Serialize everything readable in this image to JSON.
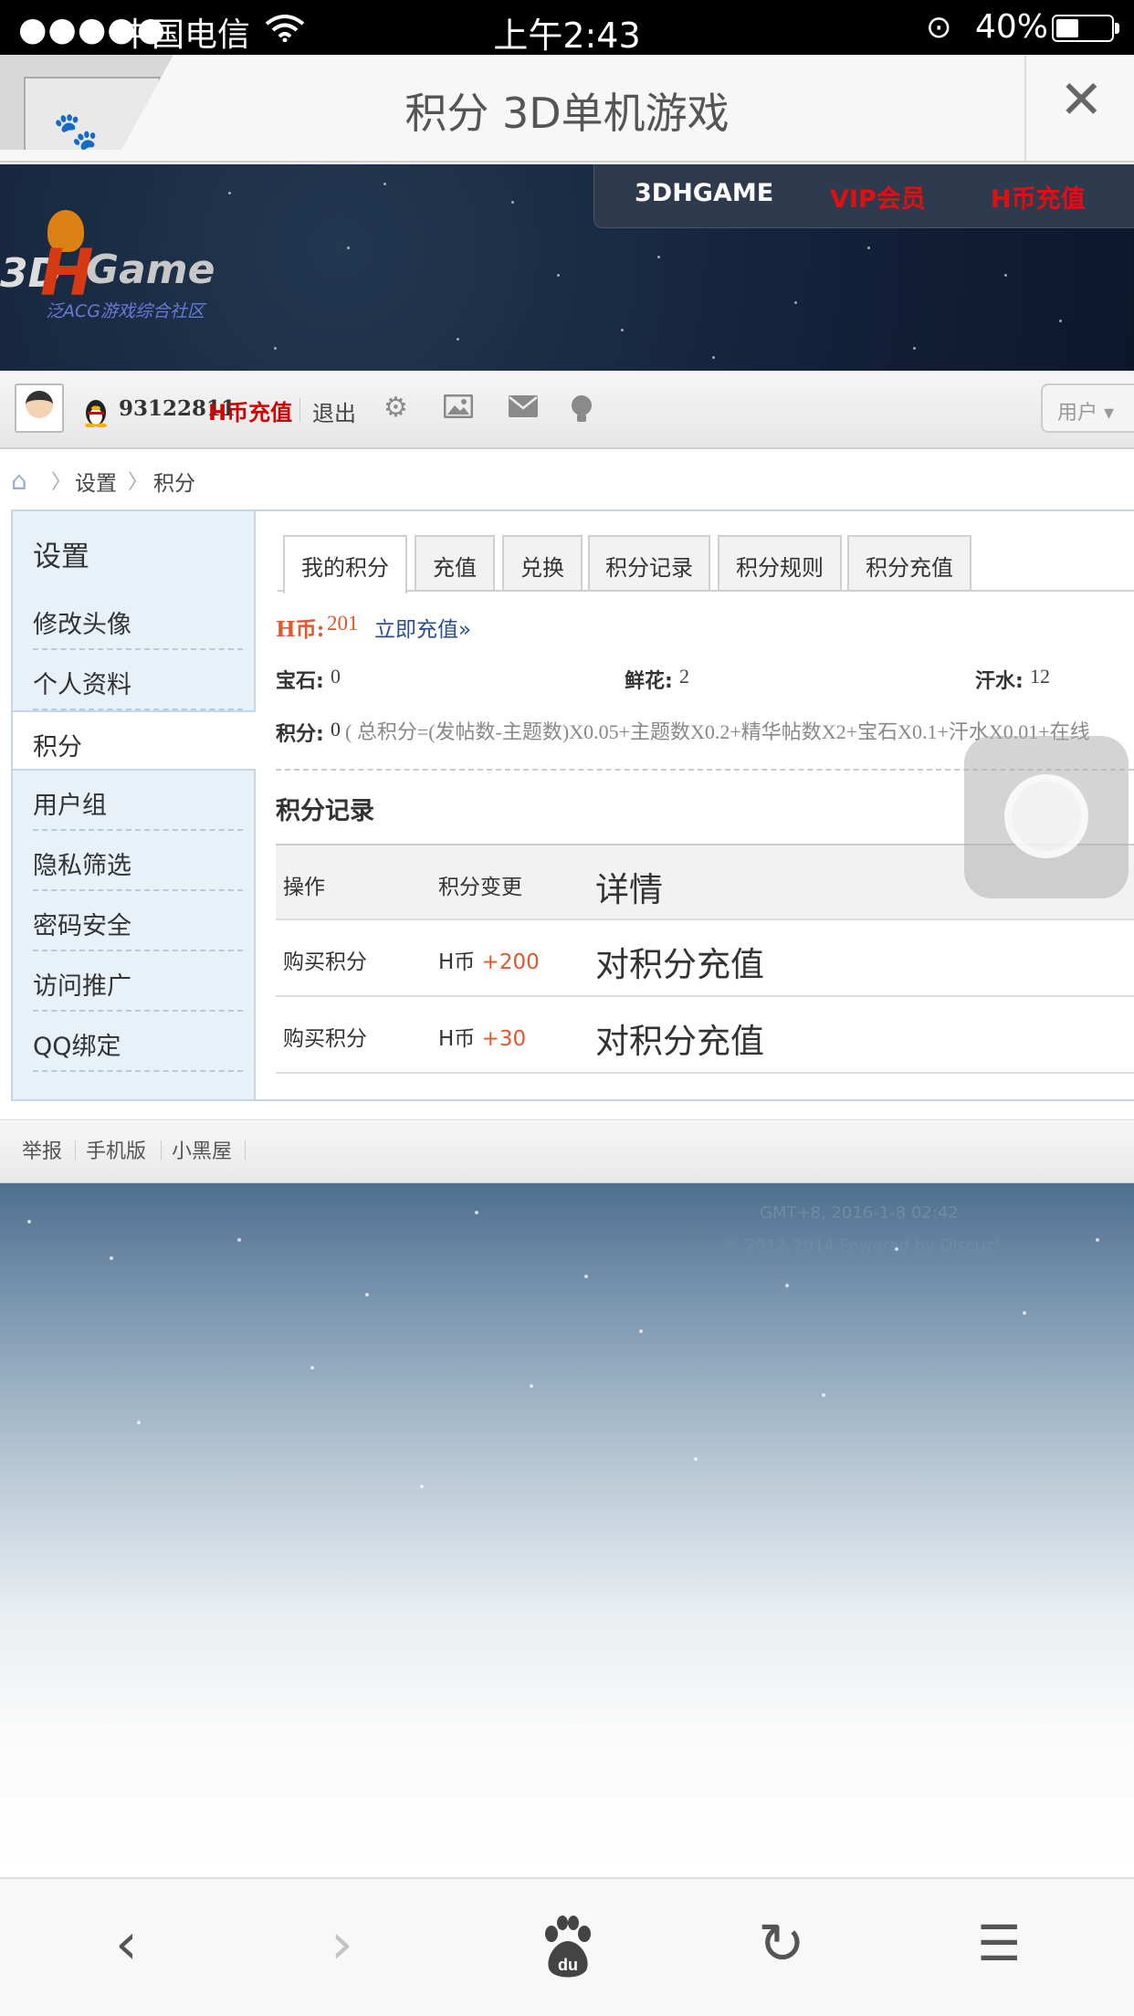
{
  "status_bar": {
    "signal": "●●●●●",
    "carrier": "中国电信",
    "time": "上午2:43",
    "battery": "40%"
  },
  "title_bar": {
    "title": "积分 3D单机游戏",
    "close": "✕"
  },
  "banner": {
    "nav": [
      "3DHGAME",
      "VIP会员",
      "H币充值"
    ],
    "nav_colors": [
      "#ffffff",
      "#e01010",
      "#e01010"
    ],
    "logo_d3": "3D",
    "logo_h": "H",
    "logo_game": "Game",
    "logo_sub": "泛ACG游戏综合社区"
  },
  "user_toolbar": {
    "uid": "93122811",
    "recharge": "H币充值",
    "logout": "退出",
    "icons": [
      "settings-icon",
      "image-icon",
      "mail-icon",
      "bulb-icon"
    ],
    "user_button": "用户 ▾"
  },
  "breadcrumb": [
    "设置",
    "积分"
  ],
  "sidebar": {
    "header": "设置",
    "items": [
      {
        "label": "修改头像"
      },
      {
        "label": "个人资料"
      },
      {
        "label": "积分"
      },
      {
        "label": "用户组"
      },
      {
        "label": "隐私筛选"
      },
      {
        "label": "密码安全"
      },
      {
        "label": "访问推广"
      },
      {
        "label": "QQ绑定"
      }
    ]
  },
  "tabs": [
    "我的积分",
    "充值",
    "兑换",
    "积分记录",
    "积分规则",
    "积分充值"
  ],
  "credits": {
    "hcoin_label": "H币:",
    "hcoin_value": "201",
    "recharge_now": "立即充值»",
    "gem_label": "宝石:",
    "gem_value": "0",
    "flower_label": "鲜花:",
    "flower_value": "2",
    "sweat_label": "汗水:",
    "sweat_value": "12",
    "points_label": "积分:",
    "points_value": "0",
    "formula": "( 总积分=(发帖数-主题数)X0.05+主题数X0.2+精华帖数X2+宝石X0.1+汗水X0.01+在线"
  },
  "record": {
    "title": "积分记录",
    "headers": [
      "操作",
      "积分变更",
      "详情"
    ],
    "rows": [
      {
        "op": "购买积分",
        "unit": "H币",
        "change": "+200",
        "detail": "对积分充值"
      },
      {
        "op": "购买积分",
        "unit": "H币",
        "change": "+30",
        "detail": "对积分充值"
      }
    ]
  },
  "footer_links": [
    "举报",
    "手机版",
    "小黑屋"
  ],
  "footer_info": {
    "gmt": "GMT+8, 2016-1-8 02:42",
    "powered": "© 2012-2014 Powered by Discuz!"
  },
  "bottom_bar": {
    "back": "‹",
    "forward": "›",
    "refresh": "↻",
    "menu": "☰"
  }
}
